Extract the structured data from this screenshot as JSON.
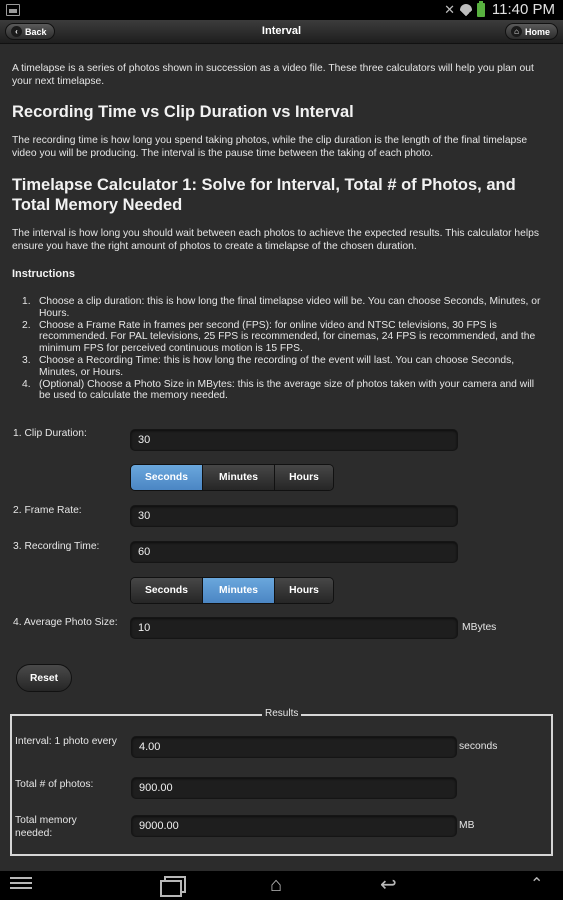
{
  "status_bar": {
    "time": "11:40 PM"
  },
  "header": {
    "back_label": "Back",
    "title": "Interval",
    "home_label": "Home"
  },
  "intro": "A timelapse is a series of photos shown in succession as a video file. These three calculators will help you plan out your next timelapse.",
  "section1": {
    "heading": "Recording Time vs Clip Duration vs Interval",
    "text": "The recording time is how long you spend taking photos, while the clip duration is the length of the final timelapse video you will be producing. The interval is the pause time between the taking of each photo."
  },
  "section2": {
    "heading": "Timelapse Calculator 1: Solve for Interval, Total # of Photos, and Total Memory Needed",
    "text": "The interval is how long you should wait between each photos to achieve the expected results. This calculator helps ensure you have the right amount of photos to create a timelapse of the chosen duration."
  },
  "instructions": {
    "heading": "Instructions",
    "steps": [
      {
        "num": "1.",
        "text": "Choose a clip duration: this is how long the final timelapse video will be. You can choose Seconds, Minutes, or Hours."
      },
      {
        "num": "2.",
        "text": "Choose a Frame Rate in frames per second (FPS): for online video and NTSC televisions, 30 FPS is recommended. For PAL televisions, 25 FPS is recommended, for cinemas, 24 FPS is recommended, and the minimum FPS for perceived continuous motion is 15 FPS."
      },
      {
        "num": "3.",
        "text": "Choose a Recording Time: this is how long the recording of the event will last. You can choose Seconds, Minutes, or Hours."
      },
      {
        "num": "4.",
        "text": "(Optional) Choose a Photo Size in MBytes: this is the average size of photos taken with your camera and will be used to calculate the memory needed."
      }
    ]
  },
  "form": {
    "clip_duration": {
      "label": "1. Clip Duration:",
      "value": "30",
      "units": [
        "Seconds",
        "Minutes",
        "Hours"
      ],
      "selected": "Seconds"
    },
    "frame_rate": {
      "label": "2. Frame Rate:",
      "value": "30"
    },
    "recording_time": {
      "label": "3. Recording Time:",
      "value": "60",
      "units": [
        "Seconds",
        "Minutes",
        "Hours"
      ],
      "selected": "Minutes"
    },
    "photo_size": {
      "label": "4. Average Photo Size:",
      "value": "10",
      "unit": "MBytes"
    },
    "reset_label": "Reset"
  },
  "results": {
    "legend": "Results",
    "interval": {
      "label": "Interval: 1 photo every",
      "value": "4.00",
      "unit": "seconds"
    },
    "total_photos": {
      "label": "Total # of photos:",
      "value": "900.00"
    },
    "total_memory": {
      "label": "Total memory needed:",
      "value": "9000.00",
      "unit": "MB"
    }
  }
}
